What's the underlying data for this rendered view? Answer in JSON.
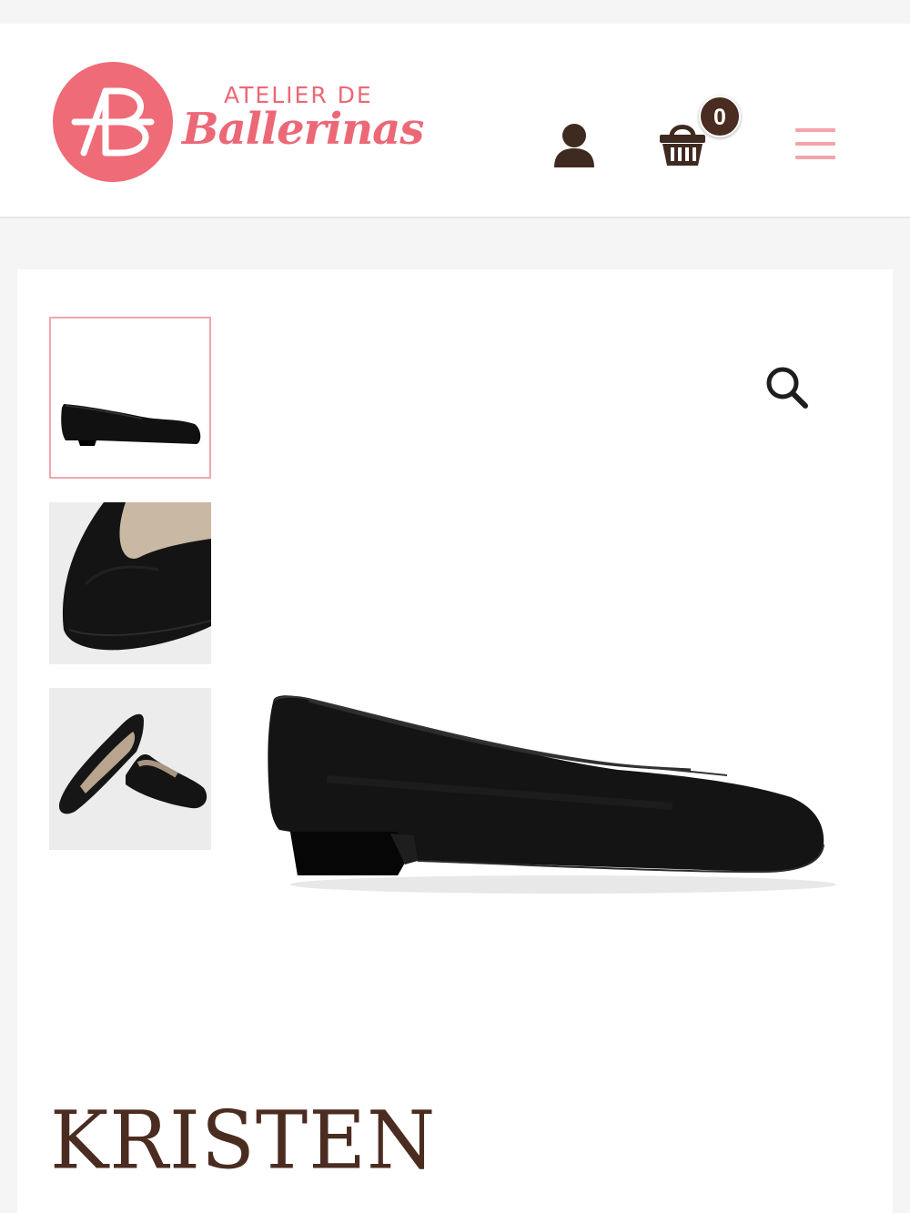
{
  "brand": {
    "line1": "ATELIER DE",
    "line2": "Ballerinas",
    "color": "#ec6876"
  },
  "header": {
    "account_icon": "user-icon",
    "cart_icon": "shopping-basket-icon",
    "cart_count": "0",
    "menu_icon": "hamburger-menu-icon",
    "accent_color": "#4b2c20"
  },
  "gallery": {
    "thumbnails": [
      {
        "name": "thumbnail-side-view",
        "active": true
      },
      {
        "name": "thumbnail-toe-closeup",
        "active": false
      },
      {
        "name": "thumbnail-pair-angle",
        "active": false
      }
    ],
    "zoom_icon": "magnifier-icon"
  },
  "product": {
    "title": "KRISTEN"
  }
}
